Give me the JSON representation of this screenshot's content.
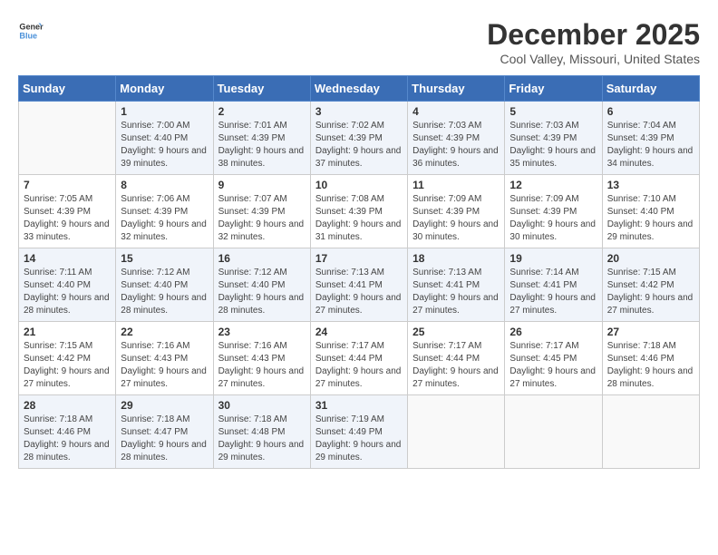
{
  "header": {
    "logo_line1": "General",
    "logo_line2": "Blue",
    "month": "December 2025",
    "location": "Cool Valley, Missouri, United States"
  },
  "weekdays": [
    "Sunday",
    "Monday",
    "Tuesday",
    "Wednesday",
    "Thursday",
    "Friday",
    "Saturday"
  ],
  "weeks": [
    [
      {
        "day": "",
        "sunrise": "",
        "sunset": "",
        "daylight": ""
      },
      {
        "day": "1",
        "sunrise": "Sunrise: 7:00 AM",
        "sunset": "Sunset: 4:40 PM",
        "daylight": "Daylight: 9 hours and 39 minutes."
      },
      {
        "day": "2",
        "sunrise": "Sunrise: 7:01 AM",
        "sunset": "Sunset: 4:39 PM",
        "daylight": "Daylight: 9 hours and 38 minutes."
      },
      {
        "day": "3",
        "sunrise": "Sunrise: 7:02 AM",
        "sunset": "Sunset: 4:39 PM",
        "daylight": "Daylight: 9 hours and 37 minutes."
      },
      {
        "day": "4",
        "sunrise": "Sunrise: 7:03 AM",
        "sunset": "Sunset: 4:39 PM",
        "daylight": "Daylight: 9 hours and 36 minutes."
      },
      {
        "day": "5",
        "sunrise": "Sunrise: 7:03 AM",
        "sunset": "Sunset: 4:39 PM",
        "daylight": "Daylight: 9 hours and 35 minutes."
      },
      {
        "day": "6",
        "sunrise": "Sunrise: 7:04 AM",
        "sunset": "Sunset: 4:39 PM",
        "daylight": "Daylight: 9 hours and 34 minutes."
      }
    ],
    [
      {
        "day": "7",
        "sunrise": "Sunrise: 7:05 AM",
        "sunset": "Sunset: 4:39 PM",
        "daylight": "Daylight: 9 hours and 33 minutes."
      },
      {
        "day": "8",
        "sunrise": "Sunrise: 7:06 AM",
        "sunset": "Sunset: 4:39 PM",
        "daylight": "Daylight: 9 hours and 32 minutes."
      },
      {
        "day": "9",
        "sunrise": "Sunrise: 7:07 AM",
        "sunset": "Sunset: 4:39 PM",
        "daylight": "Daylight: 9 hours and 32 minutes."
      },
      {
        "day": "10",
        "sunrise": "Sunrise: 7:08 AM",
        "sunset": "Sunset: 4:39 PM",
        "daylight": "Daylight: 9 hours and 31 minutes."
      },
      {
        "day": "11",
        "sunrise": "Sunrise: 7:09 AM",
        "sunset": "Sunset: 4:39 PM",
        "daylight": "Daylight: 9 hours and 30 minutes."
      },
      {
        "day": "12",
        "sunrise": "Sunrise: 7:09 AM",
        "sunset": "Sunset: 4:39 PM",
        "daylight": "Daylight: 9 hours and 30 minutes."
      },
      {
        "day": "13",
        "sunrise": "Sunrise: 7:10 AM",
        "sunset": "Sunset: 4:40 PM",
        "daylight": "Daylight: 9 hours and 29 minutes."
      }
    ],
    [
      {
        "day": "14",
        "sunrise": "Sunrise: 7:11 AM",
        "sunset": "Sunset: 4:40 PM",
        "daylight": "Daylight: 9 hours and 28 minutes."
      },
      {
        "day": "15",
        "sunrise": "Sunrise: 7:12 AM",
        "sunset": "Sunset: 4:40 PM",
        "daylight": "Daylight: 9 hours and 28 minutes."
      },
      {
        "day": "16",
        "sunrise": "Sunrise: 7:12 AM",
        "sunset": "Sunset: 4:40 PM",
        "daylight": "Daylight: 9 hours and 28 minutes."
      },
      {
        "day": "17",
        "sunrise": "Sunrise: 7:13 AM",
        "sunset": "Sunset: 4:41 PM",
        "daylight": "Daylight: 9 hours and 27 minutes."
      },
      {
        "day": "18",
        "sunrise": "Sunrise: 7:13 AM",
        "sunset": "Sunset: 4:41 PM",
        "daylight": "Daylight: 9 hours and 27 minutes."
      },
      {
        "day": "19",
        "sunrise": "Sunrise: 7:14 AM",
        "sunset": "Sunset: 4:41 PM",
        "daylight": "Daylight: 9 hours and 27 minutes."
      },
      {
        "day": "20",
        "sunrise": "Sunrise: 7:15 AM",
        "sunset": "Sunset: 4:42 PM",
        "daylight": "Daylight: 9 hours and 27 minutes."
      }
    ],
    [
      {
        "day": "21",
        "sunrise": "Sunrise: 7:15 AM",
        "sunset": "Sunset: 4:42 PM",
        "daylight": "Daylight: 9 hours and 27 minutes."
      },
      {
        "day": "22",
        "sunrise": "Sunrise: 7:16 AM",
        "sunset": "Sunset: 4:43 PM",
        "daylight": "Daylight: 9 hours and 27 minutes."
      },
      {
        "day": "23",
        "sunrise": "Sunrise: 7:16 AM",
        "sunset": "Sunset: 4:43 PM",
        "daylight": "Daylight: 9 hours and 27 minutes."
      },
      {
        "day": "24",
        "sunrise": "Sunrise: 7:17 AM",
        "sunset": "Sunset: 4:44 PM",
        "daylight": "Daylight: 9 hours and 27 minutes."
      },
      {
        "day": "25",
        "sunrise": "Sunrise: 7:17 AM",
        "sunset": "Sunset: 4:44 PM",
        "daylight": "Daylight: 9 hours and 27 minutes."
      },
      {
        "day": "26",
        "sunrise": "Sunrise: 7:17 AM",
        "sunset": "Sunset: 4:45 PM",
        "daylight": "Daylight: 9 hours and 27 minutes."
      },
      {
        "day": "27",
        "sunrise": "Sunrise: 7:18 AM",
        "sunset": "Sunset: 4:46 PM",
        "daylight": "Daylight: 9 hours and 28 minutes."
      }
    ],
    [
      {
        "day": "28",
        "sunrise": "Sunrise: 7:18 AM",
        "sunset": "Sunset: 4:46 PM",
        "daylight": "Daylight: 9 hours and 28 minutes."
      },
      {
        "day": "29",
        "sunrise": "Sunrise: 7:18 AM",
        "sunset": "Sunset: 4:47 PM",
        "daylight": "Daylight: 9 hours and 28 minutes."
      },
      {
        "day": "30",
        "sunrise": "Sunrise: 7:18 AM",
        "sunset": "Sunset: 4:48 PM",
        "daylight": "Daylight: 9 hours and 29 minutes."
      },
      {
        "day": "31",
        "sunrise": "Sunrise: 7:19 AM",
        "sunset": "Sunset: 4:49 PM",
        "daylight": "Daylight: 9 hours and 29 minutes."
      },
      {
        "day": "",
        "sunrise": "",
        "sunset": "",
        "daylight": ""
      },
      {
        "day": "",
        "sunrise": "",
        "sunset": "",
        "daylight": ""
      },
      {
        "day": "",
        "sunrise": "",
        "sunset": "",
        "daylight": ""
      }
    ]
  ]
}
